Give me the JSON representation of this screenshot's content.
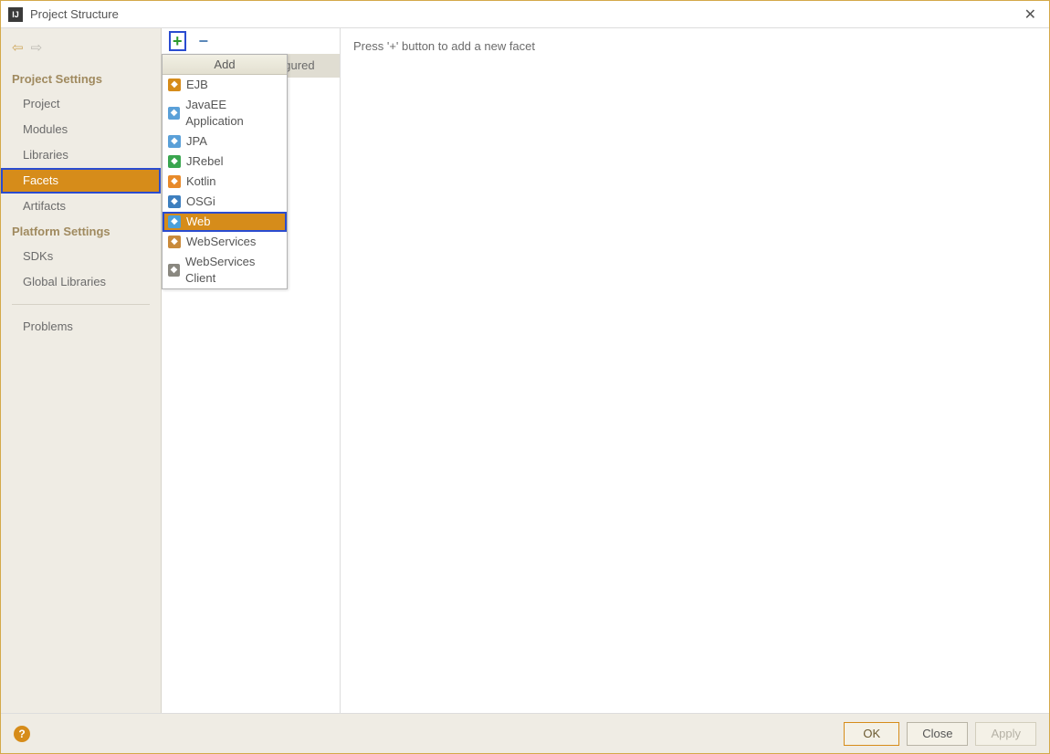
{
  "window": {
    "title": "Project Structure"
  },
  "sidebar": {
    "section1": "Project Settings",
    "items1": [
      {
        "label": "Project",
        "selected": false
      },
      {
        "label": "Modules",
        "selected": false
      },
      {
        "label": "Libraries",
        "selected": false
      },
      {
        "label": "Facets",
        "selected": true
      },
      {
        "label": "Artifacts",
        "selected": false
      }
    ],
    "section2": "Platform Settings",
    "items2": [
      {
        "label": "SDKs",
        "selected": false
      },
      {
        "label": "Global Libraries",
        "selected": false
      }
    ],
    "problems": "Problems"
  },
  "middle": {
    "tab_text_visible": "igured"
  },
  "popup": {
    "header": "Add",
    "items": [
      {
        "label": "EJB",
        "icon": "ejb",
        "selected": false
      },
      {
        "label": "JavaEE Application",
        "icon": "javaee",
        "selected": false
      },
      {
        "label": "JPA",
        "icon": "jpa",
        "selected": false
      },
      {
        "label": "JRebel",
        "icon": "jrebel",
        "selected": false
      },
      {
        "label": "Kotlin",
        "icon": "kotlin",
        "selected": false
      },
      {
        "label": "OSGi",
        "icon": "osgi",
        "selected": false
      },
      {
        "label": "Web",
        "icon": "web",
        "selected": true
      },
      {
        "label": "WebServices",
        "icon": "ws",
        "selected": false
      },
      {
        "label": "WebServices Client",
        "icon": "wsc",
        "selected": false
      }
    ]
  },
  "main": {
    "hint": "Press '+' button to add a new facet"
  },
  "footer": {
    "ok": "OK",
    "close": "Close",
    "apply": "Apply"
  },
  "icon_colors": {
    "ejb": "#d68c1a",
    "javaee": "#5aa0d8",
    "jpa": "#5aa0d8",
    "jrebel": "#3aa64f",
    "kotlin": "#e88a2a",
    "osgi": "#3d7fbf",
    "web": "#4aa0dd",
    "ws": "#c98a3a",
    "wsc": "#8a8880"
  }
}
